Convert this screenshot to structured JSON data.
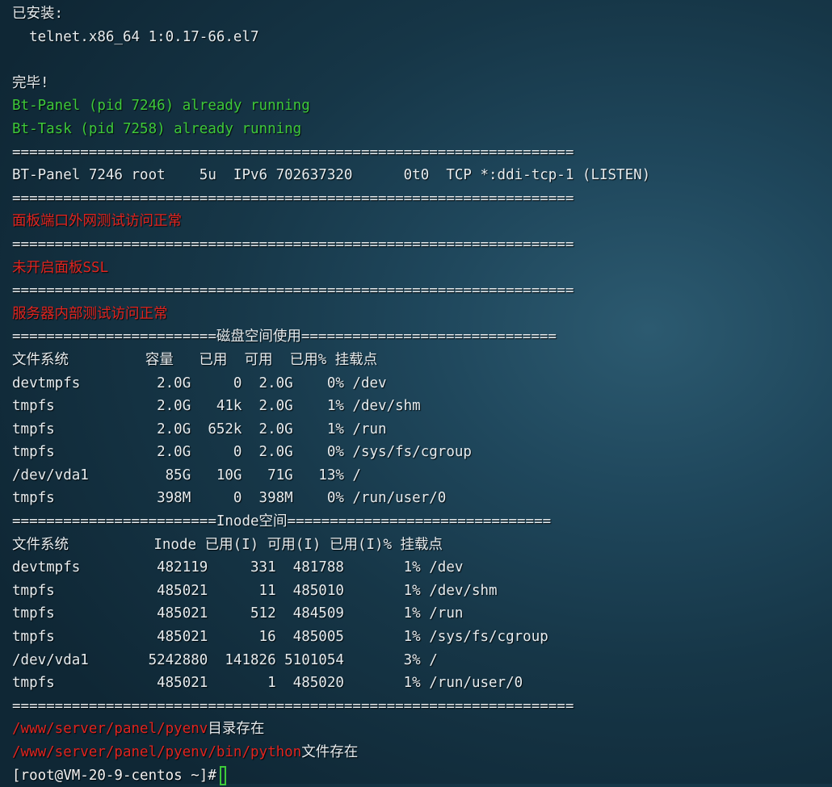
{
  "terminal": {
    "lines": [
      {
        "text": "已安装:",
        "color": "#e6ecef"
      },
      {
        "text": "  telnet.x86_64 1:0.17-66.el7",
        "color": "#e6ecef"
      },
      {
        "text": "",
        "color": "#e6ecef"
      },
      {
        "text": "完毕!",
        "color": "#e6ecef"
      },
      {
        "text": "Bt-Panel (pid 7246) already running",
        "color": "#3ec93a"
      },
      {
        "text": "Bt-Task (pid 7258) already running",
        "color": "#3ec93a"
      },
      {
        "text": "==================================================================",
        "color": "#e6ecef"
      },
      {
        "text": "BT-Panel 7246 root    5u  IPv6 702637320      0t0  TCP *:ddi-tcp-1 (LISTEN)",
        "color": "#e6ecef"
      },
      {
        "text": "==================================================================",
        "color": "#e6ecef"
      },
      {
        "text": "面板端口外网测试访问正常",
        "color": "#e0241f"
      },
      {
        "text": "==================================================================",
        "color": "#e6ecef"
      },
      {
        "text": "未开启面板SSL",
        "color": "#e0241f"
      },
      {
        "text": "==================================================================",
        "color": "#e6ecef"
      },
      {
        "text": "服务器内部测试访问正常",
        "color": "#e0241f"
      },
      {
        "text": "========================磁盘空间使用==============================",
        "color": "#e6ecef"
      },
      {
        "text": "文件系统         容量   已用  可用  已用% 挂载点",
        "color": "#e6ecef"
      },
      {
        "text": "devtmpfs         2.0G     0  2.0G    0% /dev",
        "color": "#e6ecef"
      },
      {
        "text": "tmpfs            2.0G   41k  2.0G    1% /dev/shm",
        "color": "#e6ecef"
      },
      {
        "text": "tmpfs            2.0G  652k  2.0G    1% /run",
        "color": "#e6ecef"
      },
      {
        "text": "tmpfs            2.0G     0  2.0G    0% /sys/fs/cgroup",
        "color": "#e6ecef"
      },
      {
        "text": "/dev/vda1         85G   10G   71G   13% /",
        "color": "#e6ecef"
      },
      {
        "text": "tmpfs            398M     0  398M    0% /run/user/0",
        "color": "#e6ecef"
      },
      {
        "text": "========================Inode空间===============================",
        "color": "#e6ecef"
      },
      {
        "text": "文件系统          Inode 已用(I) 可用(I) 已用(I)% 挂载点",
        "color": "#e6ecef"
      },
      {
        "text": "devtmpfs         482119     331  481788       1% /dev",
        "color": "#e6ecef"
      },
      {
        "text": "tmpfs            485021      11  485010       1% /dev/shm",
        "color": "#e6ecef"
      },
      {
        "text": "tmpfs            485021     512  484509       1% /run",
        "color": "#e6ecef"
      },
      {
        "text": "tmpfs            485021      16  485005       1% /sys/fs/cgroup",
        "color": "#e6ecef"
      },
      {
        "text": "/dev/vda1       5242880  141826 5101054       3% /",
        "color": "#e6ecef"
      },
      {
        "text": "tmpfs            485021       1  485020       1% /run/user/0",
        "color": "#e6ecef"
      },
      {
        "text": "==================================================================",
        "color": "#e6ecef"
      }
    ],
    "path_lines": [
      {
        "path": "/www/server/panel/pyenv",
        "suffix": "目录存在"
      },
      {
        "path": "/www/server/panel/pyenv/bin/python",
        "suffix": "文件存在"
      }
    ],
    "prompt": "[root@VM-20-9-centos ~]#"
  },
  "colors": {
    "text": "#e6ecef",
    "success": "#3ec93a",
    "error": "#e0241f",
    "background": "#1f475c"
  }
}
